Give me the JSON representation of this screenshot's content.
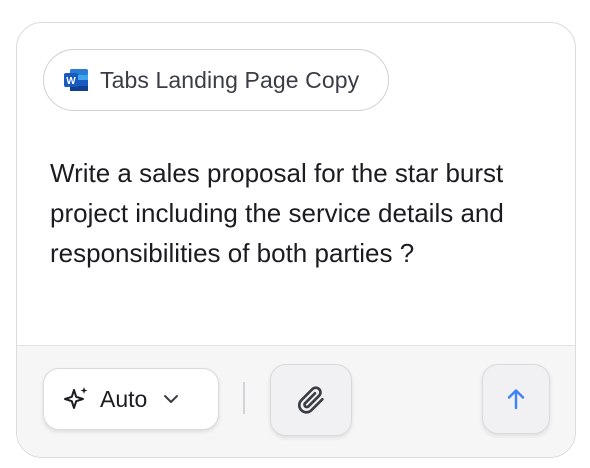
{
  "attachment": {
    "label": "Tabs Landing Page Copy",
    "icon": "word-document-icon",
    "icon_color": "#185abd"
  },
  "prompt": {
    "text": "Write a sales proposal for the star burst project including the service details and responsibilities of both parties ?"
  },
  "toolbar": {
    "model_label": "Auto",
    "model_icon": "sparkle-icon",
    "dropdown_icon": "chevron-down-icon",
    "attach_icon": "paperclip-icon",
    "send_icon": "arrow-up-icon",
    "send_color": "#3b82f6"
  }
}
